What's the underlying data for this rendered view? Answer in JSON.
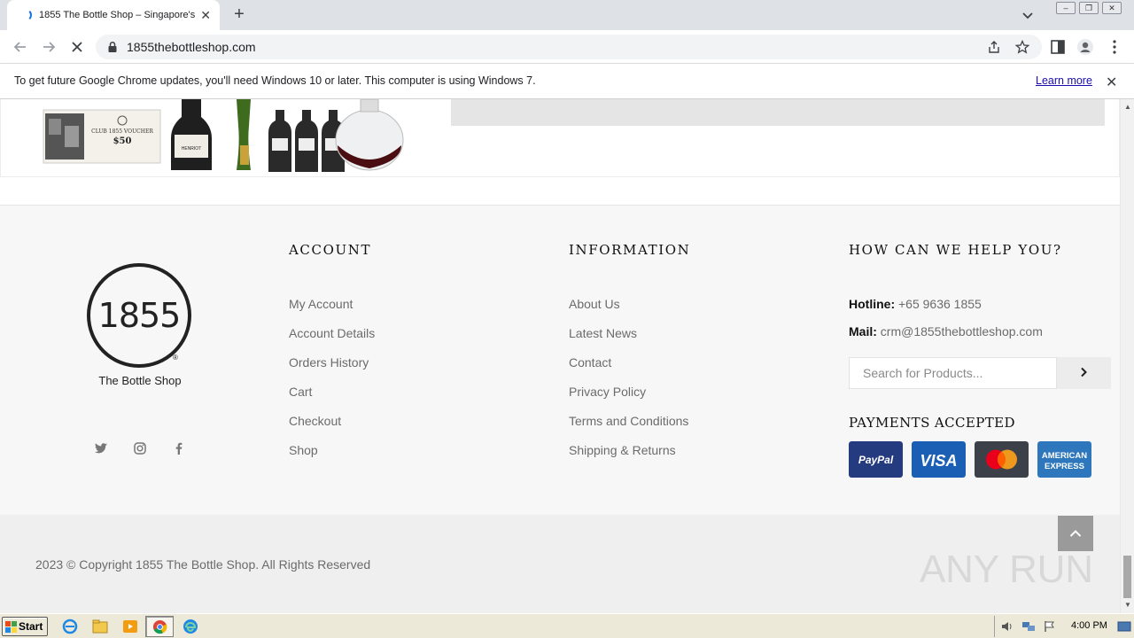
{
  "browser": {
    "tab_title": "1855 The Bottle Shop – Singapore's",
    "url": "1855thebottleshop.com",
    "infobar_message": "To get future Google Chrome updates, you'll need Windows 10 or later. This computer is using Windows 7.",
    "infobar_link": "Learn more"
  },
  "product_image": {
    "voucher_line1": "CLUB 1855 VOUCHER",
    "voucher_line2": "$50",
    "bottle_label": "HENRIOT"
  },
  "brand": {
    "logo_number": "1855",
    "logo_reg": "®",
    "logo_subtitle": "The Bottle Shop"
  },
  "account": {
    "title": "ACCOUNT",
    "links": [
      "My Account",
      "Account Details",
      "Orders History",
      "Cart",
      "Checkout",
      "Shop"
    ]
  },
  "information": {
    "title": "INFORMATION",
    "links": [
      "About Us",
      "Latest News",
      "Contact",
      "Privacy Policy",
      "Terms and Conditions",
      "Shipping & Returns"
    ]
  },
  "help": {
    "title": "HOW CAN WE HELP YOU?",
    "hotline_label": "Hotline:",
    "hotline_value": "+65 9636 1855",
    "mail_label": "Mail:",
    "mail_value": "crm@1855thebottleshop.com",
    "search_placeholder": "Search for Products...",
    "payments_title": "PAYMENTS ACCEPTED",
    "cards": [
      "PayPal",
      "VISA",
      "Mastercard",
      "American Express"
    ],
    "card_text": {
      "paypal": "PayPal",
      "visa": "VISA",
      "amex_line1": "AMERICAN",
      "amex_line2": "EXPRESS"
    }
  },
  "copyright": "2023 © Copyright 1855 The Bottle Shop. All Rights Reserved",
  "watermark": "ANY RUN",
  "taskbar": {
    "start_label": "Start",
    "clock": "4:00 PM"
  },
  "colors": {
    "footer_bg": "#f7f7f7",
    "bottom_bg": "#efefef",
    "paypal": "#253b80",
    "visa": "#1a1f71",
    "mastercard": "#3c4048",
    "amex": "#2e77bc",
    "link_blue": "#1a0dab"
  }
}
